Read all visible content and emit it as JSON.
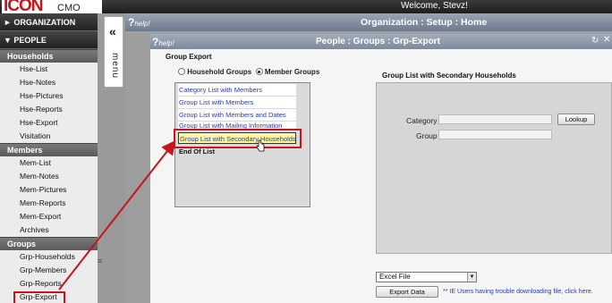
{
  "app": {
    "logo_main": "ICON",
    "logo_sub": "CMO",
    "welcome": "Welcome, Stevz!"
  },
  "sidebar": {
    "organization": "► ORGANIZATION",
    "people": "▼ PEOPLE",
    "sections": [
      {
        "header": "Households",
        "items": [
          "Hse-List",
          "Hse-Notes",
          "Hse-Pictures",
          "Hse-Reports",
          "Hse-Export",
          "Visitation"
        ]
      },
      {
        "header": "Members",
        "items": [
          "Mem-List",
          "Mem-Notes",
          "Mem-Pictures",
          "Mem-Reports",
          "Mem-Export",
          "Archives"
        ]
      },
      {
        "header": "Groups",
        "items": [
          "Grp-Households",
          "Grp-Members",
          "Grp-Reports",
          "Grp-Export"
        ]
      }
    ],
    "current_item": "Grp-Export"
  },
  "menu_tab": {
    "chevron": "«",
    "label": "menu"
  },
  "main_header": {
    "help": "help!",
    "title": "Organization : Setup : Home"
  },
  "panel": {
    "help": "help!",
    "title": "People : Groups : Grp-Export",
    "group_export_label": "Group Export",
    "radio_household": "Household Groups",
    "radio_member": "Member Groups",
    "selected_radio": "member",
    "list_items": [
      "Category List with Members",
      "Group List with Members",
      "Group List with Members and Dates",
      "Group List with Mailing Information",
      "Group List with Secondary Households",
      "End Of List"
    ],
    "selected_item": "Group List with Secondary Households",
    "secondary_title": "Group List with Secondary Households",
    "category_label": "Category",
    "group_label": "Group",
    "category_value": "",
    "group_value": "",
    "lookup_button": "Lookup",
    "format_select": "Excel File",
    "export_button": "Export Data",
    "ie_note": "** IE Users having trouble downloading file, click here."
  },
  "colors": {
    "annotation": "#c8141c",
    "header": "#7d8a9b",
    "link": "#2a3ab0"
  }
}
